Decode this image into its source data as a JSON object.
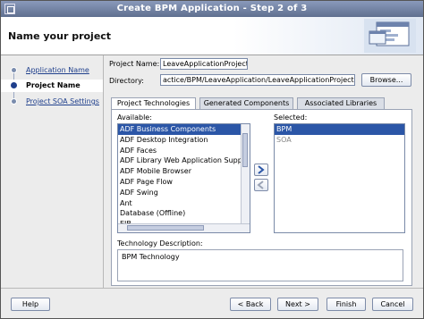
{
  "window": {
    "title": "Create BPM Application - Step 2 of 3"
  },
  "header": {
    "title": "Name your project"
  },
  "nav": {
    "items": [
      {
        "label": "Application Name",
        "state": "link"
      },
      {
        "label": "Project Name",
        "state": "current"
      },
      {
        "label": "Project SOA Settings",
        "state": "link"
      }
    ]
  },
  "form": {
    "project_name_label": "Project Name:",
    "project_name_value": "LeaveApplicationProject",
    "directory_label": "Directory:",
    "directory_value": "actice/BPM/LeaveApplication/LeaveApplicationProject",
    "browse_label": "Browse..."
  },
  "tabs": [
    {
      "label": "Project Technologies",
      "active": true
    },
    {
      "label": "Generated Components",
      "active": false
    },
    {
      "label": "Associated Libraries",
      "active": false
    }
  ],
  "available": {
    "label": "Available:",
    "items": [
      "ADF Business Components",
      "ADF Desktop Integration",
      "ADF Faces",
      "ADF Library Web Application Suppo",
      "ADF Mobile Browser",
      "ADF Page Flow",
      "ADF Swing",
      "Ant",
      "Database (Offline)",
      "EJB"
    ],
    "selected_index": 0
  },
  "selected": {
    "label": "Selected:",
    "items": [
      {
        "label": "BPM",
        "highlighted": true
      },
      {
        "label": "SOA",
        "highlighted": false
      }
    ]
  },
  "description": {
    "label": "Technology Description:",
    "text": "BPM Technology"
  },
  "buttons": {
    "help": "Help",
    "back": "< Back",
    "next": "Next >",
    "finish": "Finish",
    "cancel": "Cancel"
  },
  "colors": {
    "title_bar": "#6f7f9f",
    "selection": "#2b56a7",
    "link": "#1f3f8c"
  }
}
